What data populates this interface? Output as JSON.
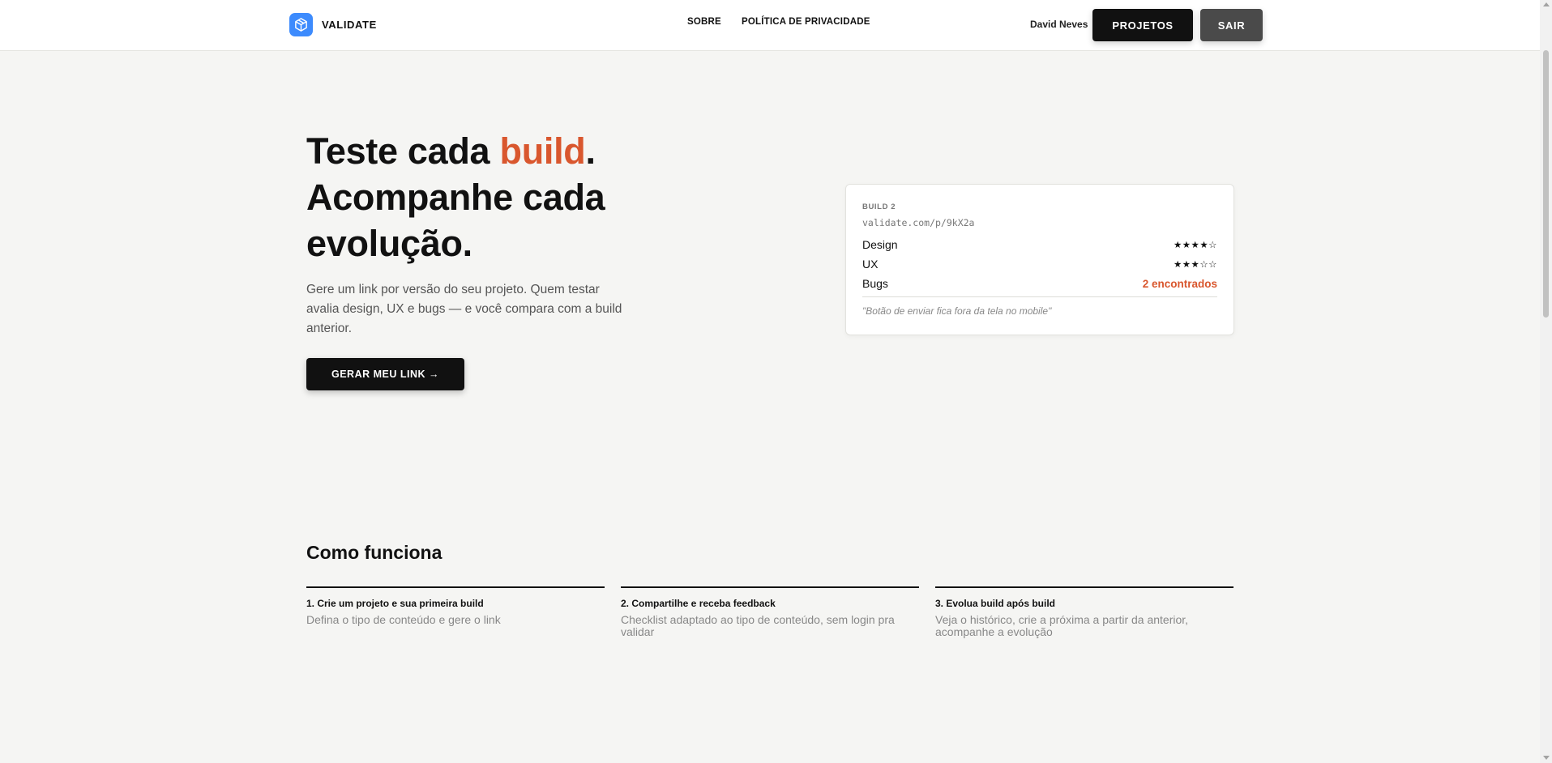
{
  "header": {
    "brand": "VALIDATE",
    "nav": [
      "SOBRE",
      "POLÍTICA DE PRIVACIDADE"
    ],
    "user_name": "David Neves",
    "projects_label": "PROJETOS",
    "logout_label": "SAIR"
  },
  "hero": {
    "title_part1": "Teste cada ",
    "title_accent": "build",
    "title_part2": ".",
    "title_line2": "Acompanhe cada",
    "title_line3": "evolução.",
    "subtitle": "Gere um link por versão do seu projeto. Quem testar avalia design, UX e bugs — e você compara com a build anterior.",
    "cta_label": "GERAR MEU LINK →"
  },
  "build_card": {
    "label": "BUILD 2",
    "url": "validate.com/p/9kX2a",
    "rows": [
      {
        "name": "Design",
        "value": "★★★★☆"
      },
      {
        "name": "UX",
        "value": "★★★☆☆"
      },
      {
        "name": "Bugs",
        "value": "2 encontrados"
      }
    ],
    "quote": "\"Botão de enviar fica fora da tela no mobile\""
  },
  "how_it_works": {
    "title": "Como funciona",
    "steps": [
      {
        "title": "1. Crie um projeto e sua primeira build",
        "description": "Defina o tipo de conteúdo e gere o link"
      },
      {
        "title": "2. Compartilhe e receba feedback",
        "description": "Checklist adaptado ao tipo de conteúdo, sem login pra validar"
      },
      {
        "title": "3. Evolua build após build",
        "description": "Veja o histórico, crie a próxima a partir da anterior, acompanhe a evolução"
      }
    ]
  },
  "colors": {
    "accent": "#d9572e",
    "brand_icon": "#3d8bfd",
    "dark": "#111111"
  }
}
